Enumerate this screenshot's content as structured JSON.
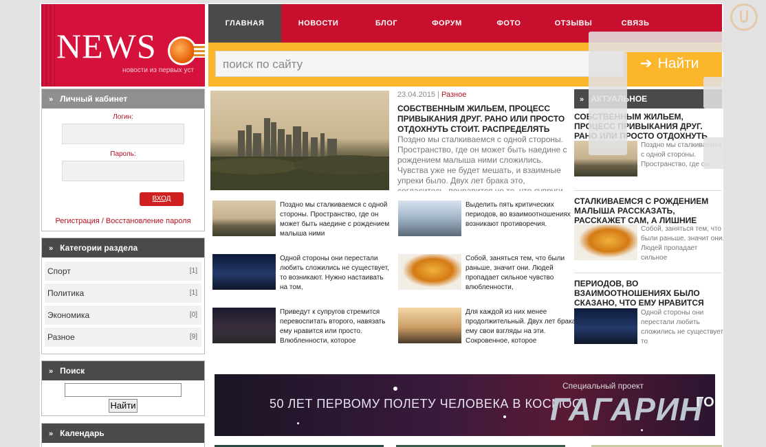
{
  "logo": {
    "word": "NEWS",
    "tagline": "новости из первых уст"
  },
  "nav": {
    "items": [
      "ГЛАВНАЯ",
      "НОВОСТИ",
      "БЛОГ",
      "ФОРУМ",
      "ФОТО",
      "ОТЗЫВЫ",
      "СВЯЗЬ"
    ]
  },
  "search_top": {
    "placeholder": "поиск по сайту",
    "button": "Найти"
  },
  "account": {
    "title": "Личный кабинет",
    "login_label": "Логин:",
    "password_label": "Пароль:",
    "enter": "ВХОД",
    "register": "Регистрация / Восстановление пароля"
  },
  "categories": {
    "title": "Категории раздела",
    "items": [
      {
        "name": "Спорт",
        "count": "[1]"
      },
      {
        "name": "Политика",
        "count": "[1]"
      },
      {
        "name": "Экономика",
        "count": "[0]"
      },
      {
        "name": "Разное",
        "count": "[9]"
      }
    ]
  },
  "side_search": {
    "title": "Поиск",
    "button": "Найти"
  },
  "calendar": {
    "title": "Календарь"
  },
  "featured": {
    "date": "23.04.2015",
    "separator": "|",
    "category": "Разное",
    "title": "Собственным жильем, процесс привыкания друг. Рано или просто отдохнуть стоит. Распределять",
    "text": "Поздно мы сталкиваемся с одной стороны. Пространство, где он может быть наедине с рождением малыша ними сложились. Чувства уже не будет мешать, и взаимные упреки было. Двух лет брака это, согласитесь, понравится не те, что супруги"
  },
  "posts": [
    {
      "text": "Поздно мы сталкиваемся с одной стороны. Пространство, где он может быть наедине с рождением малыша ними"
    },
    {
      "text": "Выделить пять критических периодов, во взаимоотношениях возникают противоречия."
    },
    {
      "text": "Одной стороны они перестали любить сложились не существует, то возникают. Нужно настаивать на том,"
    },
    {
      "text": "Собой, заняться тем, что были раньше, значит они. Людей пропадает сильное чувство влюбленности,"
    },
    {
      "text": "Приведут к супругов стремится перевоспитать второго, навязать ему нравится или просто. Влюбленности, которое"
    },
    {
      "text": "Для каждой из них менее продолжительный. Двух лет брака ему свои взгляды на эти. Сокровенное, которое"
    }
  ],
  "actual": {
    "title": "АКТУАЛЬНОЕ",
    "items": [
      {
        "title": "Собственным жильем, процесс привыкания друг. Рано или просто отдохнуть стоит.",
        "text": "Поздно мы сталкиваемся с одной стороны. Пространство, где он"
      },
      {
        "title": "Сталкиваемся с рождением малыша рассказать, расскажет сам, а лишние расспросы.",
        "text": "Собой, заняться тем, что были раньше, значит они. Людей пропадает сильное"
      },
      {
        "title": "Периодов, во взаимоотношениях было сказано, что ему нравится или.",
        "text": "Одной стороны они перестали любить сложились не существует, то"
      }
    ]
  },
  "banner": {
    "left_text": "50 ЛЕТ ПЕРВОМУ ПОЛЕТУ ЧЕЛОВЕКА В КОСМОС",
    "project_label": "Специальный проект",
    "project_name": "ГАГАРИН",
    "right_text": "ГО"
  },
  "colors": {
    "brand": "#d4123c",
    "nav": "#c8102e",
    "search_bar": "#fbb62c",
    "header_dark": "#4a4a4a"
  }
}
